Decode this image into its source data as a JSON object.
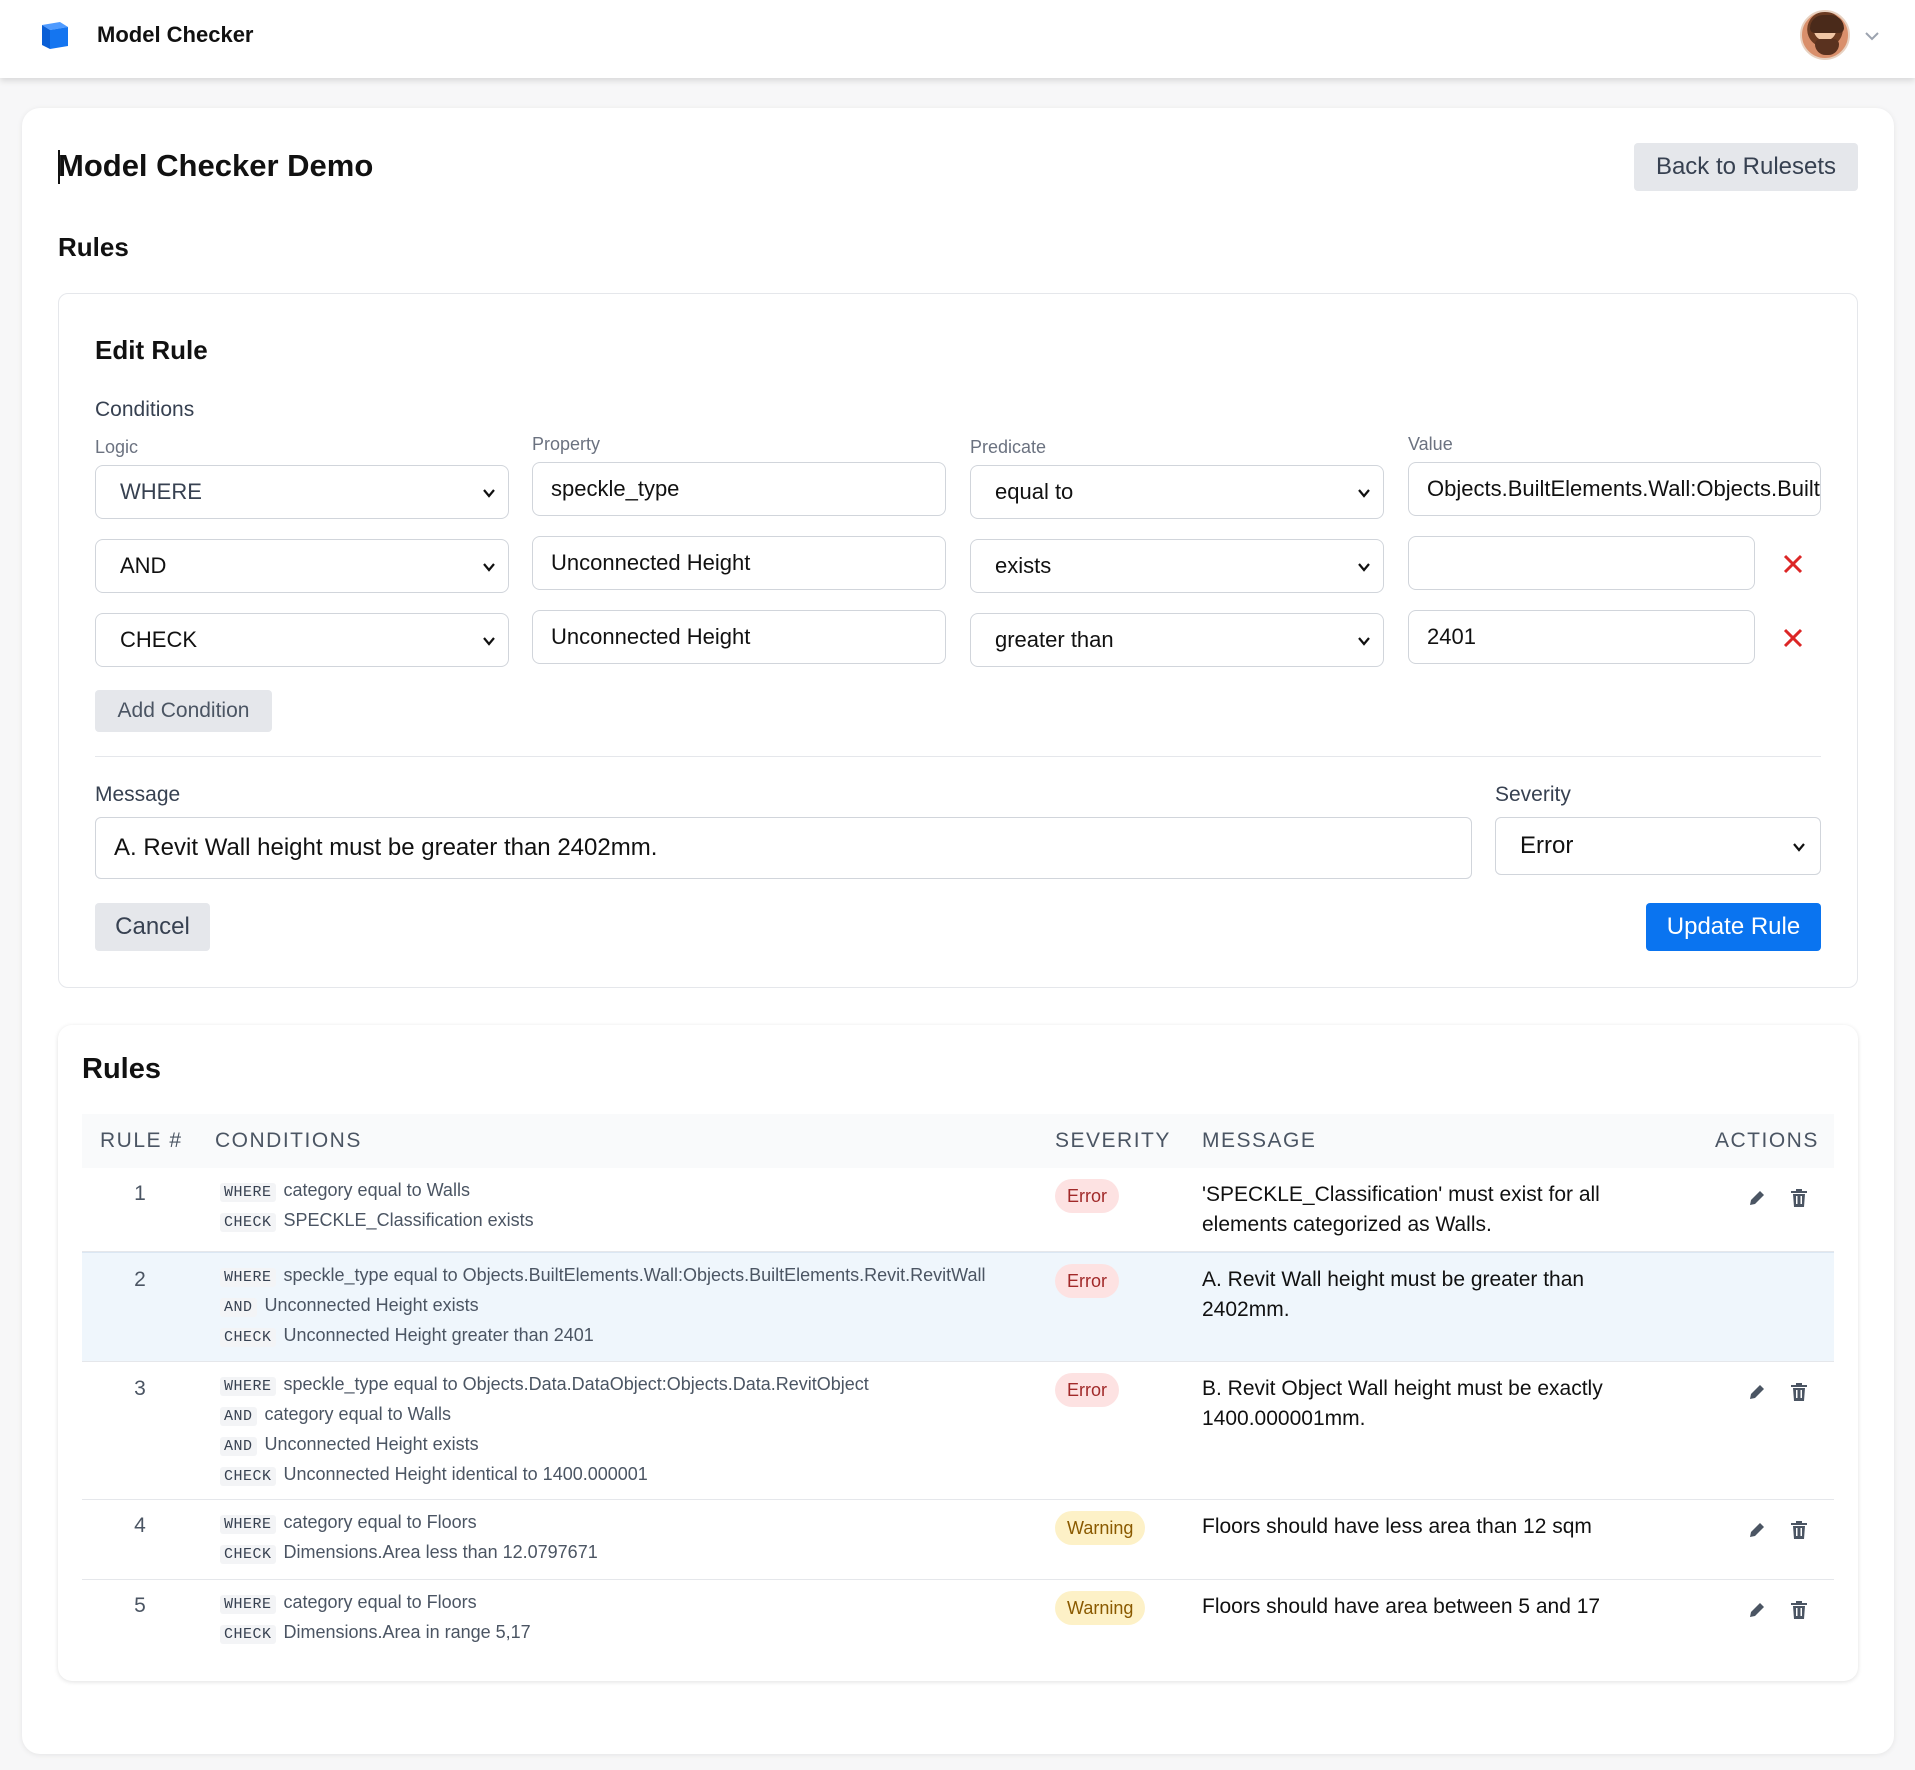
{
  "app": {
    "title": "Model Checker"
  },
  "page": {
    "title": "Model Checker Demo",
    "back_label": "Back to Rulesets",
    "section_title": "Rules"
  },
  "editor": {
    "title": "Edit Rule",
    "conditions_label": "Conditions",
    "labels": {
      "logic": "Logic",
      "property": "Property",
      "predicate": "Predicate",
      "value": "Value"
    },
    "conditions": [
      {
        "logic": "WHERE",
        "property": "speckle_type",
        "predicate": "equal to",
        "value": "Objects.BuiltElements.Wall:Objects.BuiltElements.Revit.RevitWall"
      },
      {
        "logic": "AND",
        "property": "Unconnected Height",
        "predicate": "exists",
        "value": ""
      },
      {
        "logic": "CHECK",
        "property": "Unconnected Height",
        "predicate": "greater than",
        "value": "2401"
      }
    ],
    "add_condition_label": "Add Condition",
    "message_label": "Message",
    "message_value": "A. Revit Wall height must be greater than 2402mm.",
    "severity_label": "Severity",
    "severity_value": "Error",
    "cancel_label": "Cancel",
    "update_label": "Update Rule"
  },
  "rules_table": {
    "title": "Rules",
    "headers": {
      "rule": "RULE #",
      "conditions": "CONDITIONS",
      "severity": "SEVERITY",
      "message": "MESSAGE",
      "actions": "ACTIONS"
    },
    "rows": [
      {
        "num": "1",
        "conditions": [
          {
            "kw": "WHERE",
            "text": "category equal to Walls"
          },
          {
            "kw": "CHECK",
            "text": "SPECKLE_Classification exists"
          }
        ],
        "severity": "Error",
        "message": "'SPECKLE_Classification' must exist for all elements categorized as Walls."
      },
      {
        "num": "2",
        "conditions": [
          {
            "kw": "WHERE",
            "text": "speckle_type equal to Objects.BuiltElements.Wall:Objects.BuiltElements.Revit.RevitWall"
          },
          {
            "kw": "AND",
            "text": "Unconnected Height exists"
          },
          {
            "kw": "CHECK",
            "text": "Unconnected Height greater than 2401"
          }
        ],
        "severity": "Error",
        "message": "A. Revit Wall height must be greater than 2402mm."
      },
      {
        "num": "3",
        "conditions": [
          {
            "kw": "WHERE",
            "text": "speckle_type equal to Objects.Data.DataObject:Objects.Data.RevitObject"
          },
          {
            "kw": "AND",
            "text": "category equal to Walls"
          },
          {
            "kw": "AND",
            "text": "Unconnected Height exists"
          },
          {
            "kw": "CHECK",
            "text": "Unconnected Height identical to 1400.000001"
          }
        ],
        "severity": "Error",
        "message": "B. Revit Object Wall height must be exactly 1400.000001mm."
      },
      {
        "num": "4",
        "conditions": [
          {
            "kw": "WHERE",
            "text": "category equal to Floors"
          },
          {
            "kw": "CHECK",
            "text": "Dimensions.Area less than 12.0797671"
          }
        ],
        "severity": "Warning",
        "message": "Floors should have less area than 12 sqm"
      },
      {
        "num": "5",
        "conditions": [
          {
            "kw": "WHERE",
            "text": "category equal to Floors"
          },
          {
            "kw": "CHECK",
            "text": "Dimensions.Area in range 5,17"
          }
        ],
        "severity": "Warning",
        "message": "Floors should have area between 5 and 17"
      }
    ]
  },
  "colors": {
    "accent": "#0a74f0",
    "error_bg": "#fde2e2",
    "warning_bg": "#fdf1c7",
    "remove": "#dc2626"
  },
  "icons": {
    "logo": "blue-cube-icon",
    "edit": "pencil-icon",
    "delete": "trash-icon",
    "remove": "x-icon"
  }
}
